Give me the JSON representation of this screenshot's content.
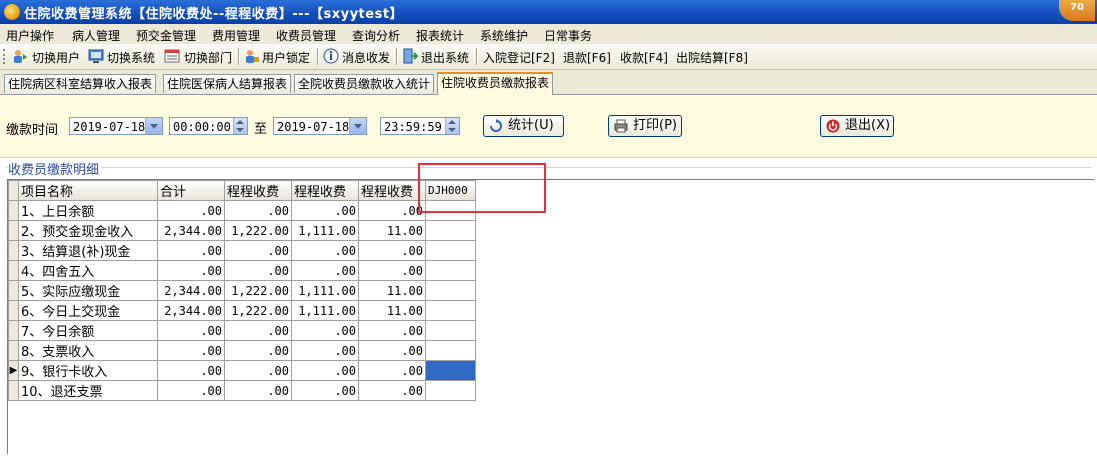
{
  "window": {
    "title": "住院收费管理系统【住院收费处--程程收费】---【sxyytest】",
    "badge": "70"
  },
  "menu": [
    "用户操作",
    "病人管理",
    "预交金管理",
    "费用管理",
    "收费员管理",
    "查询分析",
    "报表统计",
    "系统维护",
    "日常事务"
  ],
  "toolbar": {
    "switch_user": "切换用户",
    "switch_system": "切换系统",
    "switch_dept": "切换部门",
    "lock_user": "用户锁定",
    "messages": "消息收发",
    "exit_system": "退出系统",
    "admit": "入院登记[F2]",
    "refund": "退款[F6]",
    "collect": "收款[F4]",
    "discharge": "出院结算[F8]"
  },
  "tabs": [
    "住院病区科室结算收入报表",
    "住院医保病人结算报表",
    "全院收费员缴款收入统计",
    "住院收费员缴款报表"
  ],
  "active_tab": 3,
  "filter": {
    "label": "缴款时间",
    "date_from": "2019-07-18",
    "time_from": "00:00:00",
    "to_label": "至",
    "date_to": "2019-07-18",
    "time_to": "23:59:59",
    "stats_button": "统计(U)",
    "print_button": "打印(P)",
    "exit_button": "退出(X)"
  },
  "group_caption": "收费员缴款明细",
  "grid": {
    "headers": [
      "项目名称",
      "合计",
      "程程收费",
      "程程收费",
      "程程收费",
      "DJH000"
    ],
    "rows": [
      [
        "1、上日余额",
        ".00",
        ".00",
        ".00",
        ".00",
        ""
      ],
      [
        "2、预交金现金收入",
        "2,344.00",
        "1,222.00",
        "1,111.00",
        "11.00",
        ""
      ],
      [
        "3、结算退(补)现金",
        ".00",
        ".00",
        ".00",
        ".00",
        ""
      ],
      [
        "4、四舍五入",
        ".00",
        ".00",
        ".00",
        ".00",
        ""
      ],
      [
        "5、实际应缴现金",
        "2,344.00",
        "1,222.00",
        "1,111.00",
        "11.00",
        ""
      ],
      [
        "6、今日上交现金",
        "2,344.00",
        "1,222.00",
        "1,111.00",
        "11.00",
        ""
      ],
      [
        "7、今日余额",
        ".00",
        ".00",
        ".00",
        ".00",
        ""
      ],
      [
        "8、支票收入",
        ".00",
        ".00",
        ".00",
        ".00",
        ""
      ],
      [
        "9、银行卡收入",
        ".00",
        ".00",
        ".00",
        ".00",
        ""
      ],
      [
        "10、退还支票",
        ".00",
        ".00",
        ".00",
        ".00",
        ""
      ]
    ],
    "current_row": 8
  },
  "colors": {
    "selection": "#316ac5",
    "highlight_box": "#e1323c",
    "active_tab_border": "#e68b2c"
  }
}
